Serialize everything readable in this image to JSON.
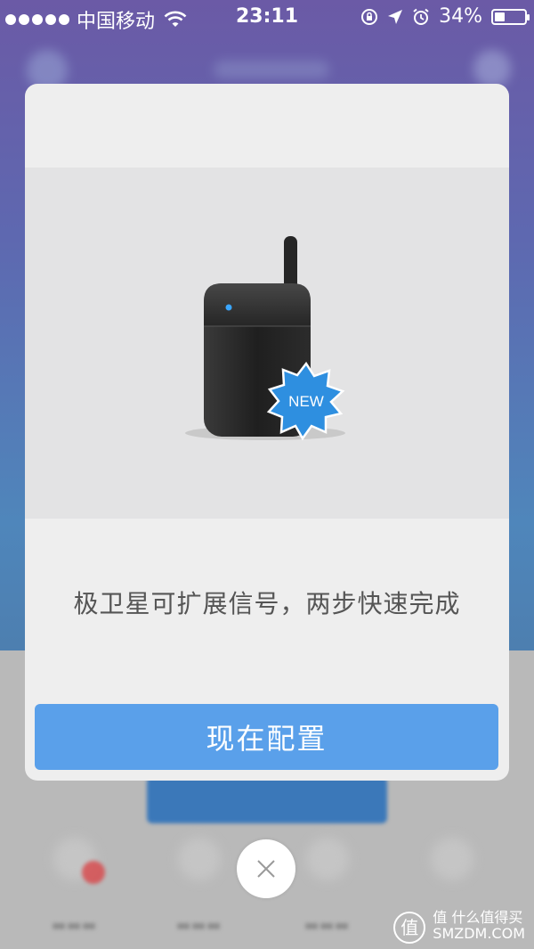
{
  "status_bar": {
    "carrier": "中国移动",
    "time": "23:11",
    "battery": "34%",
    "battery_level": 0.34
  },
  "modal": {
    "product_badge": "NEW",
    "message": "极卫星可扩展信号，两步快速完成",
    "primary_button": "现在配置"
  },
  "colors": {
    "accent": "#5aa0ea",
    "modal_bg": "#eeeeee",
    "hero_bg": "#e3e3e4"
  },
  "icons": {
    "close": "close-icon",
    "wifi": "wifi-icon"
  },
  "watermark": {
    "line1": "值 什么值得买",
    "line2": "SMZDM.COM"
  }
}
